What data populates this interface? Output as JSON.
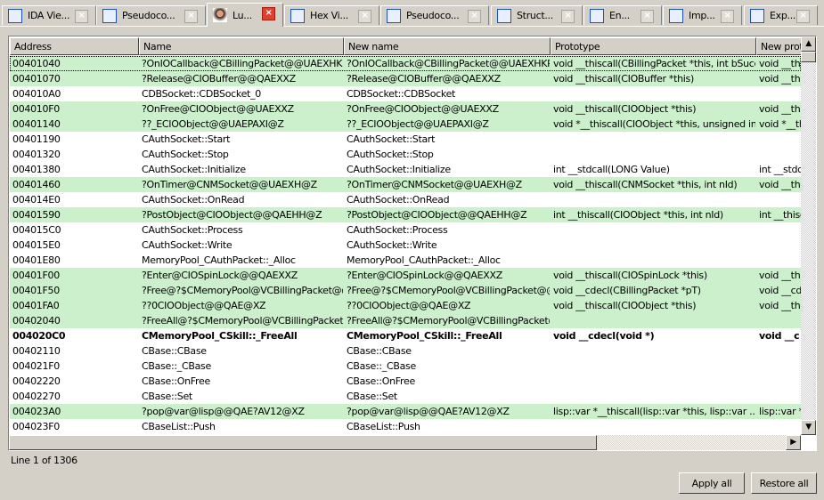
{
  "tabs": [
    {
      "label": "IDA Vie...",
      "icon": "ida-view-icon"
    },
    {
      "label": "Pseudoco...",
      "icon": "pseudocode-icon"
    },
    {
      "label": "Lu...",
      "icon": "portrait-icon",
      "active": true
    },
    {
      "label": "Hex Vi...",
      "icon": "hex-view-icon"
    },
    {
      "label": "Pseudoco...",
      "icon": "pseudocode-icon"
    },
    {
      "label": "Struct...",
      "icon": "structures-icon"
    },
    {
      "label": "En...",
      "icon": "enums-icon"
    },
    {
      "label": "Imp...",
      "icon": "imports-icon"
    },
    {
      "label": "Exp...",
      "icon": "exports-icon"
    }
  ],
  "columns": [
    "Address",
    "Name",
    "New name",
    "Prototype",
    "New proto"
  ],
  "rows": [
    {
      "address": "00401040",
      "name": "?OnIOCallback@CBillingPacket@@UAEXHKP...",
      "new_name": "?OnIOCallback@CBillingPacket@@UAEXHKP...",
      "prototype": "void __thiscall(CBillingPacket *this, int bSucc...",
      "new_proto": "void __this",
      "highlight": true
    },
    {
      "address": "00401070",
      "name": "?Release@CIOBuffer@@QAEXXZ",
      "new_name": "?Release@CIOBuffer@@QAEXXZ",
      "prototype": "void __thiscall(CIOBuffer *this)",
      "new_proto": "void __this",
      "highlight": true
    },
    {
      "address": "004010A0",
      "name": "CDBSocket::CDBSocket_0",
      "new_name": "CDBSocket::CDBSocket",
      "prototype": "",
      "new_proto": "",
      "highlight": false
    },
    {
      "address": "004010F0",
      "name": "?OnFree@CIOObject@@UAEXXZ",
      "new_name": "?OnFree@CIOObject@@UAEXXZ",
      "prototype": "void __thiscall(CIOObject *this)",
      "new_proto": "void __this",
      "highlight": true
    },
    {
      "address": "00401140",
      "name": "??_ECIOObject@@UAEPAXI@Z",
      "new_name": "??_ECIOObject@@UAEPAXI@Z",
      "prototype": "void *__thiscall(CIOObject *this, unsigned int)",
      "new_proto": "void *__th",
      "highlight": true
    },
    {
      "address": "00401190",
      "name": "CAuthSocket::Start",
      "new_name": "CAuthSocket::Start",
      "prototype": "",
      "new_proto": "",
      "highlight": false
    },
    {
      "address": "00401320",
      "name": "CAuthSocket::Stop",
      "new_name": "CAuthSocket::Stop",
      "prototype": "",
      "new_proto": "",
      "highlight": false
    },
    {
      "address": "00401380",
      "name": "CAuthSocket::Initialize",
      "new_name": "CAuthSocket::Initialize",
      "prototype": "int __stdcall(LONG Value)",
      "new_proto": "int __stdca",
      "highlight": false
    },
    {
      "address": "00401460",
      "name": "?OnTimer@CNMSocket@@UAEXH@Z",
      "new_name": "?OnTimer@CNMSocket@@UAEXH@Z",
      "prototype": "void __thiscall(CNMSocket *this, int nId)",
      "new_proto": "void __this",
      "highlight": true
    },
    {
      "address": "004014E0",
      "name": "CAuthSocket::OnRead",
      "new_name": "CAuthSocket::OnRead",
      "prototype": "",
      "new_proto": "",
      "highlight": false
    },
    {
      "address": "00401590",
      "name": "?PostObject@CIOObject@@QAEHH@Z",
      "new_name": "?PostObject@CIOObject@@QAEHH@Z",
      "prototype": "int __thiscall(CIOObject *this, int nId)",
      "new_proto": "int __thisc",
      "highlight": true
    },
    {
      "address": "004015C0",
      "name": "CAuthSocket::Process",
      "new_name": "CAuthSocket::Process",
      "prototype": "",
      "new_proto": "",
      "highlight": false
    },
    {
      "address": "004015E0",
      "name": "CAuthSocket::Write",
      "new_name": "CAuthSocket::Write",
      "prototype": "",
      "new_proto": "",
      "highlight": false
    },
    {
      "address": "00401E80",
      "name": "MemoryPool_CAuthPacket::_Alloc",
      "new_name": "MemoryPool_CAuthPacket::_Alloc",
      "prototype": "",
      "new_proto": "",
      "highlight": false
    },
    {
      "address": "00401F00",
      "name": "?Enter@CIOSpinLock@@QAEXXZ",
      "new_name": "?Enter@CIOSpinLock@@QAEXXZ",
      "prototype": "void __thiscall(CIOSpinLock *this)",
      "new_proto": "void __this",
      "highlight": true
    },
    {
      "address": "00401F50",
      "name": "?Free@?$CMemoryPool@VCBillingPacket@@...",
      "new_name": "?Free@?$CMemoryPool@VCBillingPacket@@...",
      "prototype": "void __cdecl(CBillingPacket *pT)",
      "new_proto": "void __cde",
      "highlight": true
    },
    {
      "address": "00401FA0",
      "name": "??0CIOObject@@QAE@XZ",
      "new_name": "??0CIOObject@@QAE@XZ",
      "prototype": "void __thiscall(CIOObject *this)",
      "new_proto": "void __this",
      "highlight": true
    },
    {
      "address": "00402040",
      "name": "?FreeAll@?$CMemoryPool@VCBillingPacket@...",
      "new_name": "?FreeAll@?$CMemoryPool@VCBillingPacket@...",
      "prototype": "",
      "new_proto": "",
      "highlight": true
    },
    {
      "address": "004020C0",
      "name": "CMemoryPool_CSkill::_FreeAll",
      "new_name": "CMemoryPool_CSkill::_FreeAll",
      "prototype": "void __cdecl(void *)",
      "new_proto": "void __c",
      "highlight": false,
      "bold": true
    },
    {
      "address": "00402110",
      "name": "CBase::CBase",
      "new_name": "CBase::CBase",
      "prototype": "",
      "new_proto": "",
      "highlight": false
    },
    {
      "address": "004021F0",
      "name": "CBase::_CBase",
      "new_name": "CBase::_CBase",
      "prototype": "",
      "new_proto": "",
      "highlight": false
    },
    {
      "address": "00402220",
      "name": "CBase::OnFree",
      "new_name": "CBase::OnFree",
      "prototype": "",
      "new_proto": "",
      "highlight": false
    },
    {
      "address": "00402270",
      "name": "CBase::Set",
      "new_name": "CBase::Set",
      "prototype": "",
      "new_proto": "",
      "highlight": false
    },
    {
      "address": "004023A0",
      "name": "?pop@var@lisp@@QAE?AV12@XZ",
      "new_name": "?pop@var@lisp@@QAE?AV12@XZ",
      "prototype": "lisp::var *__thiscall(lisp::var *this, lisp::var ...",
      "new_proto": "lisp::var *",
      "highlight": true
    },
    {
      "address": "004023F0",
      "name": "CBaseList::Push",
      "new_name": "CBaseList::Push",
      "prototype": "",
      "new_proto": "",
      "highlight": false
    }
  ],
  "status": "Line 1 of 1306",
  "buttons": {
    "apply_all": "Apply all",
    "restore_all": "Restore all"
  },
  "colors": {
    "highlight": "#ccf0cc",
    "close_active": "#e04030"
  }
}
